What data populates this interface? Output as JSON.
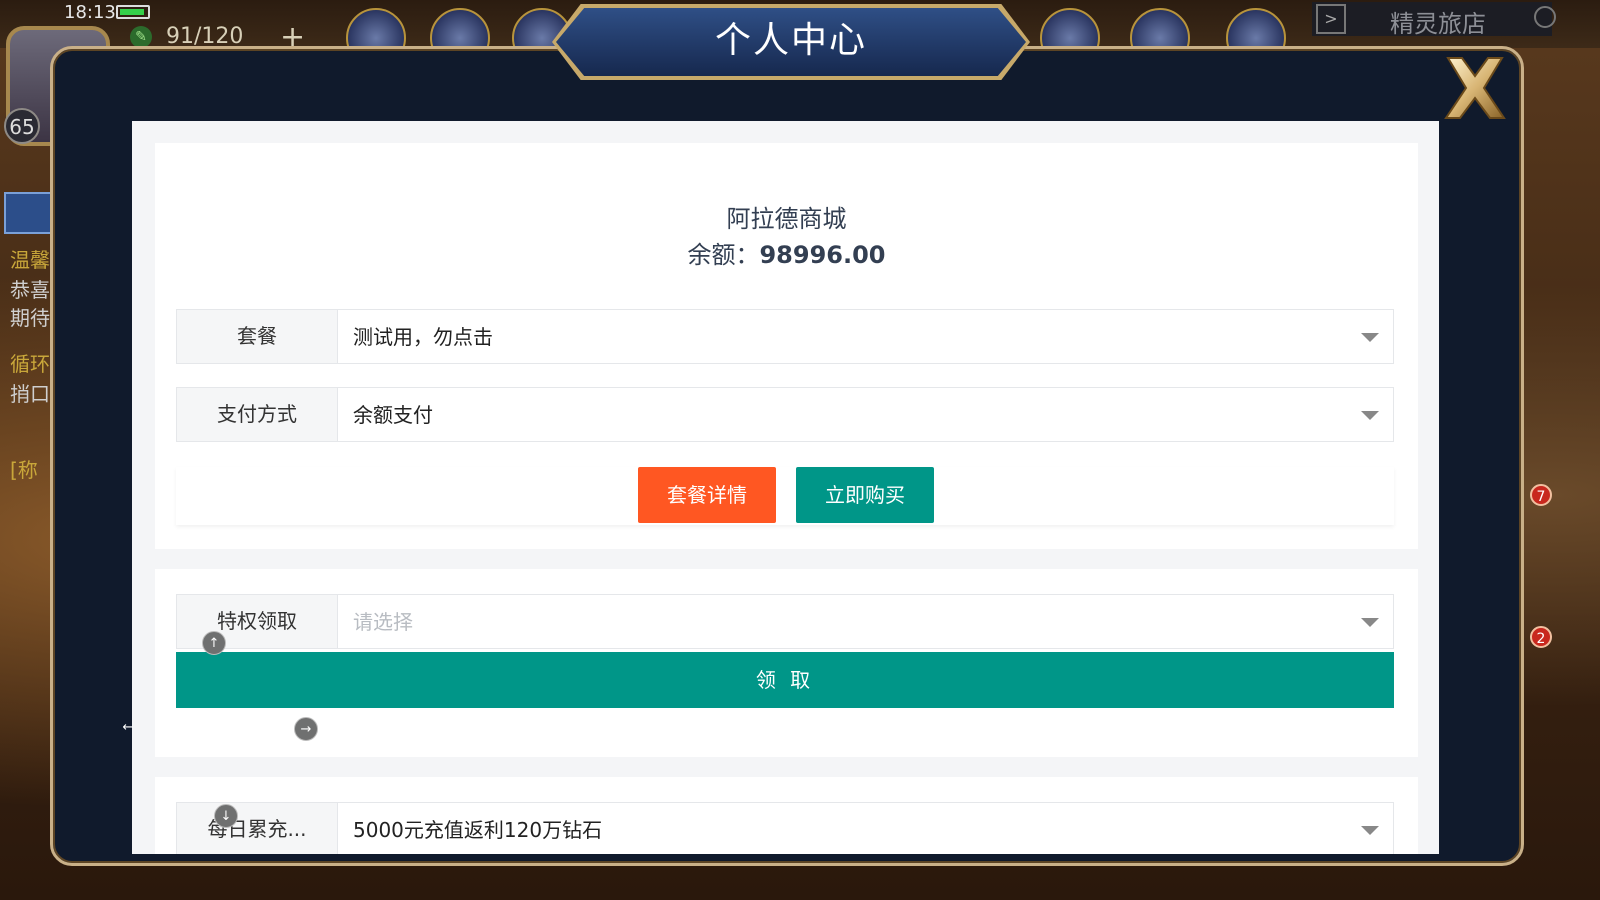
{
  "status_bar": {
    "time": "18:13",
    "energy": "91/120",
    "level": "65"
  },
  "game_hud": {
    "shop_label": "精灵旅店",
    "left_lines": [
      "温馨",
      "恭喜",
      "期待",
      "循环",
      "捎口",
      "[称"
    ],
    "badges": [
      "7",
      "2"
    ]
  },
  "modal": {
    "title": "个人中心",
    "shop_name": "阿拉德商城",
    "balance_label": "余额：",
    "balance_value": "98996.00",
    "package": {
      "label": "套餐",
      "value": "测试用，勿点击"
    },
    "payment": {
      "label": "支付方式",
      "value": "余额支付"
    },
    "details_button": "套餐详情",
    "buy_button": "立即购买",
    "privilege": {
      "label": "特权领取",
      "placeholder": "请选择"
    },
    "claim_button": "领 取",
    "daily": {
      "label": "每日累充...",
      "value": "5000元充值返利120万钻石"
    }
  },
  "colors": {
    "orange": "#ff5722",
    "teal": "#009688",
    "frame": "#101a2c",
    "gold": "#c9b088"
  },
  "icons": [
    "battery-icon",
    "energy-icon",
    "plus-icon",
    "close-icon",
    "caret-down-icon",
    "search-icon",
    "arrow-right-icon"
  ]
}
